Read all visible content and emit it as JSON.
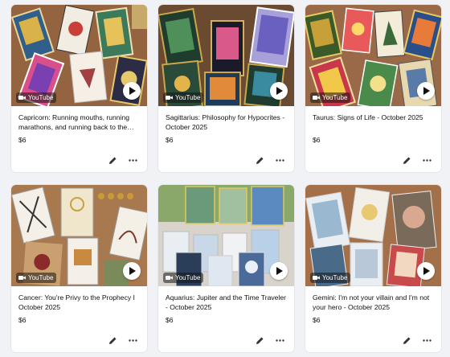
{
  "products": [
    {
      "title": "Capricorn: Running mouths, running marathons, and running back to the…",
      "price": "$6",
      "badge": "YouTube"
    },
    {
      "title": "Sagittarius: Philosophy for Hypocrites - October 2025",
      "price": "$6",
      "badge": "YouTube"
    },
    {
      "title": "Taurus: Signs of Life - October 2025",
      "price": "$6",
      "badge": "YouTube"
    },
    {
      "title": "Cancer: You're Privy to the Prophecy I October 2025",
      "price": "$6",
      "badge": "YouTube"
    },
    {
      "title": "Aquarius: Jupiter and the Time Traveler - October 2025",
      "price": "$6",
      "badge": "YouTube"
    },
    {
      "title": "Gemini: I'm not your villain and I'm not your hero - October 2025",
      "price": "$6",
      "badge": "YouTube"
    }
  ],
  "icons": {
    "badge_icon": "video-camera-icon",
    "play": "play-icon",
    "edit": "pencil-icon",
    "more": "more-horizontal-icon"
  },
  "colors": {
    "page_bg": "#f1f2f6",
    "card_bg": "#ffffff"
  }
}
